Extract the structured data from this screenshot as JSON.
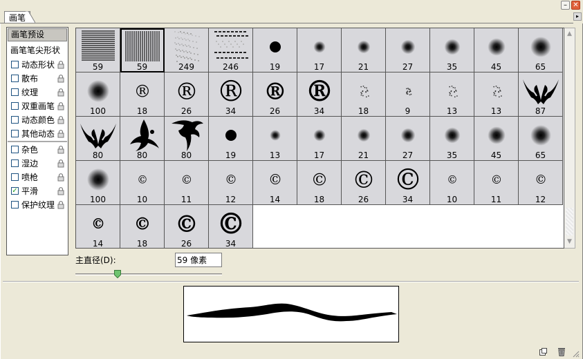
{
  "window": {
    "minimize_label": "–",
    "close_label": "✕"
  },
  "tab": {
    "label": "画笔",
    "menu_arrow": "▸"
  },
  "sidebar": {
    "preset_label": "画笔预设",
    "tip_label": "画笔笔尖形状",
    "options": [
      {
        "label": "动态形状",
        "checked": false
      },
      {
        "label": "散布",
        "checked": false
      },
      {
        "label": "纹理",
        "checked": false
      },
      {
        "label": "双重画笔",
        "checked": false
      },
      {
        "label": "动态颜色",
        "checked": false
      },
      {
        "label": "其他动态",
        "checked": false
      },
      {
        "label": "杂色",
        "checked": false
      },
      {
        "label": "湿边",
        "checked": false
      },
      {
        "label": "喷枪",
        "checked": false
      },
      {
        "label": "平滑",
        "checked": true
      },
      {
        "label": "保护纹理",
        "checked": false
      }
    ]
  },
  "brushes": [
    {
      "size": "59",
      "kind": "hlines"
    },
    {
      "size": "59",
      "kind": "vlines",
      "selected": true
    },
    {
      "size": "249",
      "kind": "speckle"
    },
    {
      "size": "246",
      "kind": "dashes"
    },
    {
      "size": "19",
      "kind": "hard"
    },
    {
      "size": "17",
      "kind": "soft"
    },
    {
      "size": "21",
      "kind": "soft"
    },
    {
      "size": "27",
      "kind": "soft"
    },
    {
      "size": "35",
      "kind": "soft"
    },
    {
      "size": "45",
      "kind": "soft"
    },
    {
      "size": "65",
      "kind": "soft"
    },
    {
      "size": "100",
      "kind": "soft"
    },
    {
      "size": "18",
      "kind": "registered"
    },
    {
      "size": "26",
      "kind": "registered"
    },
    {
      "size": "34",
      "kind": "registered"
    },
    {
      "size": "26",
      "kind": "registered-bold"
    },
    {
      "size": "34",
      "kind": "registered-bold"
    },
    {
      "size": "18",
      "kind": "scatter"
    },
    {
      "size": "9",
      "kind": "scatter"
    },
    {
      "size": "13",
      "kind": "scatter"
    },
    {
      "size": "13",
      "kind": "scatter"
    },
    {
      "size": "87",
      "kind": "tribal-bat"
    },
    {
      "size": "80",
      "kind": "tribal-bat"
    },
    {
      "size": "80",
      "kind": "tribal-swirl"
    },
    {
      "size": "80",
      "kind": "tribal-flame"
    },
    {
      "size": "19",
      "kind": "hard"
    },
    {
      "size": "13",
      "kind": "soft"
    },
    {
      "size": "17",
      "kind": "soft"
    },
    {
      "size": "21",
      "kind": "soft"
    },
    {
      "size": "27",
      "kind": "soft"
    },
    {
      "size": "35",
      "kind": "soft"
    },
    {
      "size": "45",
      "kind": "soft"
    },
    {
      "size": "65",
      "kind": "soft"
    },
    {
      "size": "100",
      "kind": "soft"
    },
    {
      "size": "10",
      "kind": "copyright"
    },
    {
      "size": "11",
      "kind": "copyright"
    },
    {
      "size": "12",
      "kind": "copyright"
    },
    {
      "size": "14",
      "kind": "copyright"
    },
    {
      "size": "18",
      "kind": "copyright"
    },
    {
      "size": "26",
      "kind": "copyright"
    },
    {
      "size": "34",
      "kind": "copyright"
    },
    {
      "size": "10",
      "kind": "copyright"
    },
    {
      "size": "11",
      "kind": "copyright"
    },
    {
      "size": "12",
      "kind": "copyright"
    },
    {
      "size": "14",
      "kind": "copyright-bold"
    },
    {
      "size": "18",
      "kind": "copyright-bold"
    },
    {
      "size": "26",
      "kind": "copyright-bold"
    },
    {
      "size": "34",
      "kind": "copyright-bold"
    }
  ],
  "diameter": {
    "label": "主直径(D):",
    "value": "59 像素",
    "slider_fraction": 0.27
  },
  "scrollbar": {
    "up": "▲",
    "down": "▼"
  },
  "icons": {
    "new": "new-brush-icon",
    "delete": "trash-icon"
  }
}
